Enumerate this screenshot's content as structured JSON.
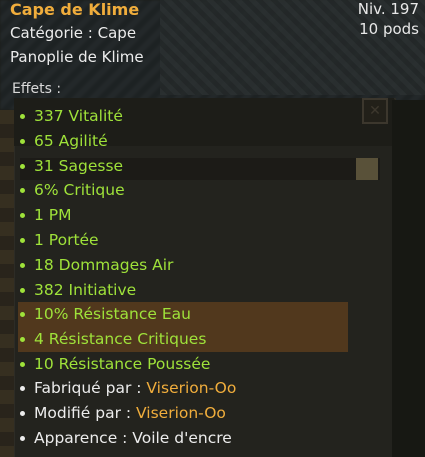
{
  "item": {
    "name": "Cape de Klime",
    "level": "Niv. 197",
    "weight": "10 pods",
    "category": "Catégorie : Cape",
    "set": "Panoplie de Klime"
  },
  "effects_label": "Effets :",
  "effects": [
    "337 Vitalité",
    "65 Agilité",
    "31 Sagesse",
    "6% Critique",
    "1 PM",
    "1 Portée",
    "18 Dommages Air",
    "382 Initiative",
    "10% Résistance Eau",
    "4 Résistance Critiques",
    "10 Résistance Poussée"
  ],
  "crafted_by": {
    "label": "Fabriqué par : ",
    "value": "Viserion-Oo"
  },
  "modified_by": {
    "label": "Modifié par : ",
    "value": "Viserion-Oo"
  },
  "appearance": "Apparence : Voile d'encre",
  "colors": {
    "title": "#f0ad3c",
    "effect": "#9fe23a",
    "text": "#ececec"
  }
}
